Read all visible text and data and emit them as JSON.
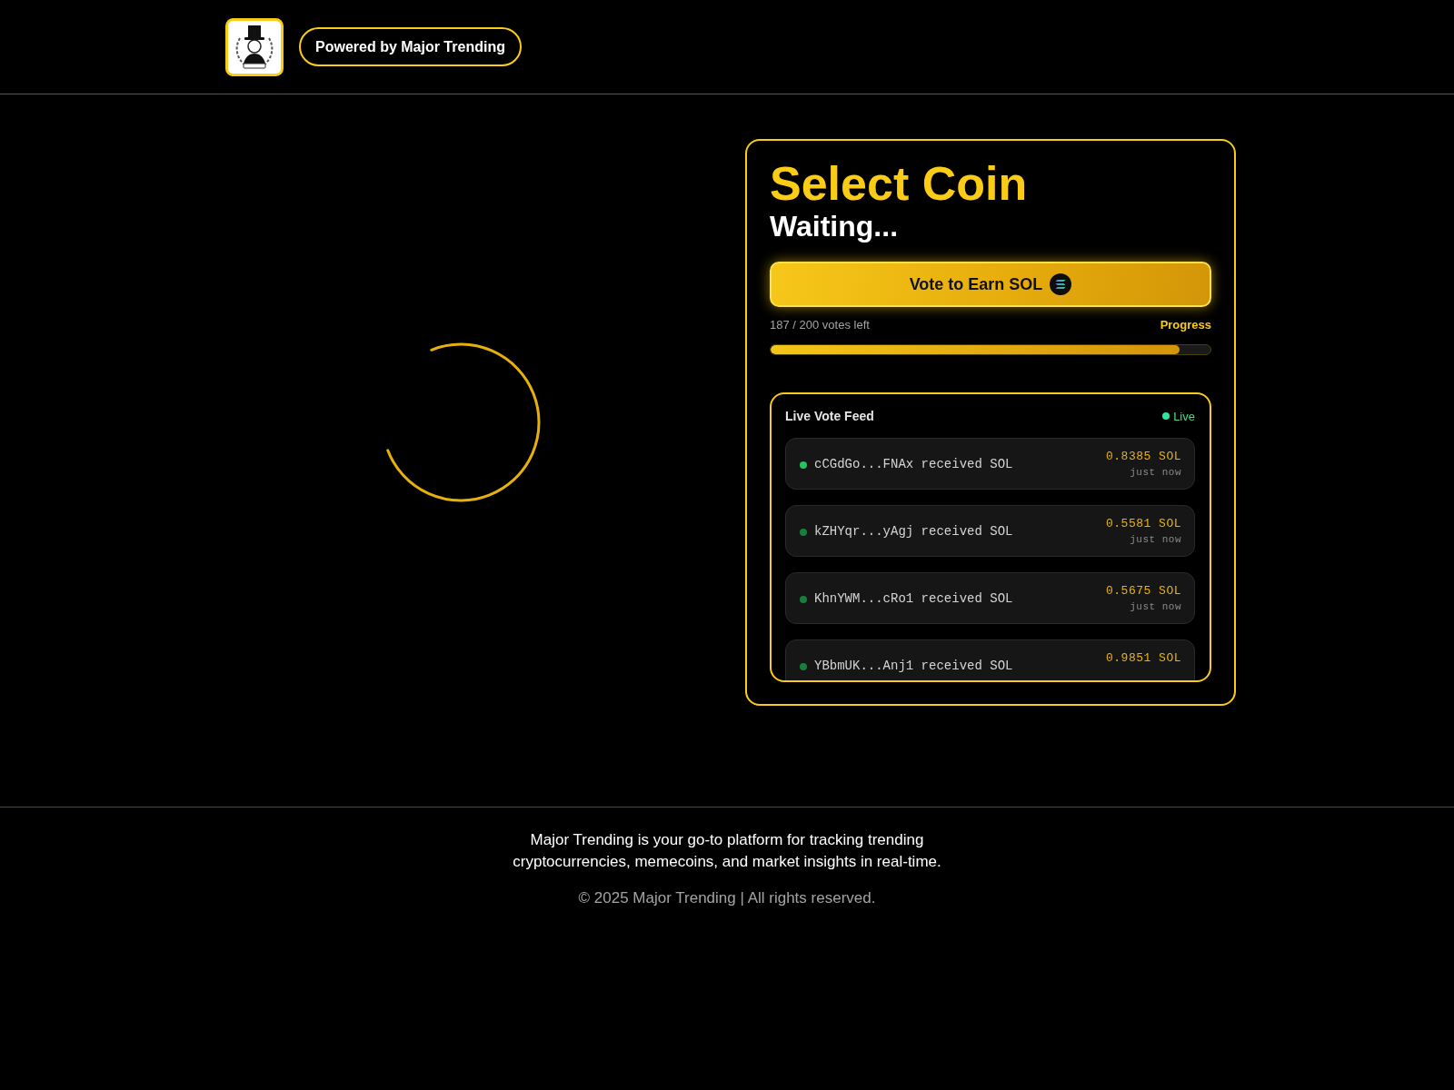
{
  "header": {
    "badge_text": "Powered by Major Trending"
  },
  "vote_card": {
    "title": "Select Coin",
    "status": "Waiting...",
    "vote_button": "Vote to Earn SOL",
    "votes_left": "187 / 200 votes left",
    "progress_label": "Progress",
    "progress": {
      "level": 0.93
    },
    "feed": {
      "title": "Live Vote Feed",
      "live_label": "Live",
      "items": [
        {
          "text": "cCGdGo...FNAx received SOL",
          "amount": "0.8385 SOL",
          "time": "just now",
          "color": "#22c55e"
        },
        {
          "text": "kZHYqr...yAgj received SOL",
          "amount": "0.5581 SOL",
          "time": "just now",
          "color": "#15803d"
        },
        {
          "text": "KhnYWM...cRo1 received SOL",
          "amount": "0.5675 SOL",
          "time": "just now",
          "color": "#15803d"
        },
        {
          "text": "YBbmUK...Anj1 received SOL",
          "amount": "0.9851 SOL",
          "color": "#15803d"
        }
      ]
    }
  },
  "footer": {
    "description": "Major Trending is your go-to platform for tracking trending cryptocurrencies, memecoins, and market insights in real-time.",
    "copyright": "© 2025 Major Trending | All rights reserved."
  }
}
